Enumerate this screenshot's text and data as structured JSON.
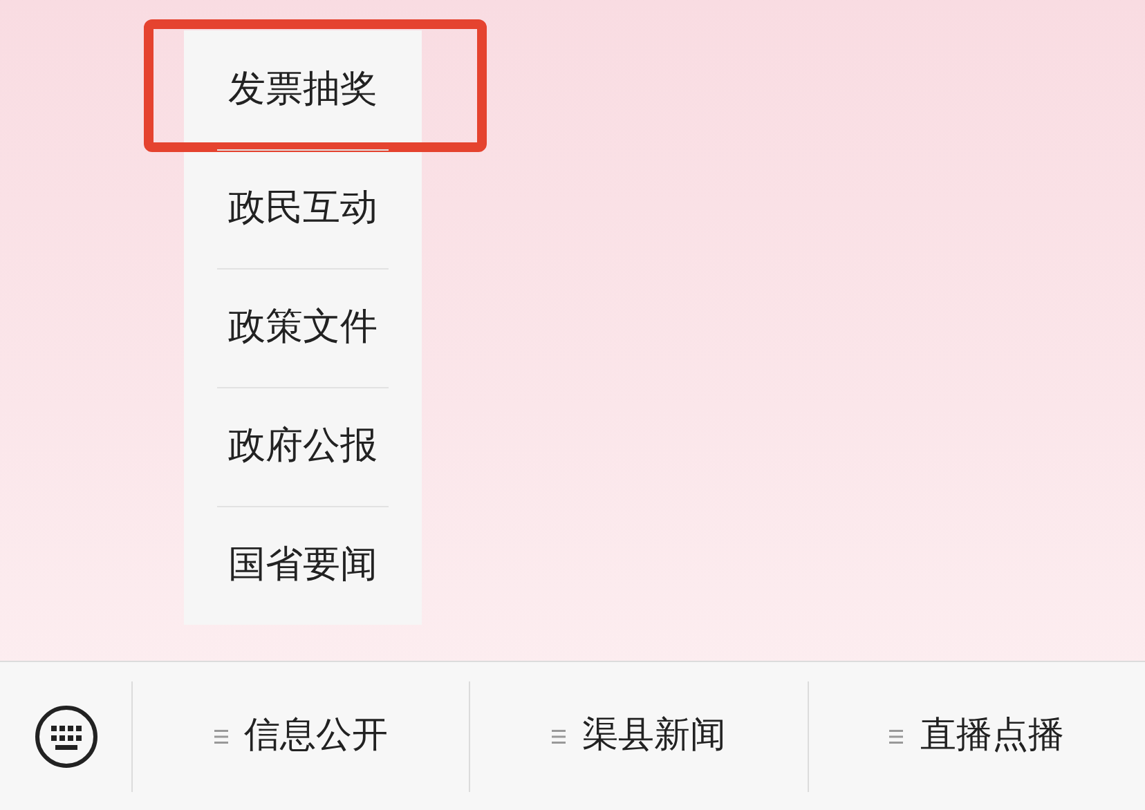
{
  "submenu": {
    "items": [
      {
        "label": "发票抽奖",
        "highlighted": true
      },
      {
        "label": "政民互动",
        "highlighted": false
      },
      {
        "label": "政策文件",
        "highlighted": false
      },
      {
        "label": "政府公报",
        "highlighted": false
      },
      {
        "label": "国省要闻",
        "highlighted": false
      }
    ]
  },
  "bottom_menu": {
    "items": [
      {
        "label": "信息公开"
      },
      {
        "label": "渠县新闻"
      },
      {
        "label": "直播点播"
      }
    ]
  }
}
